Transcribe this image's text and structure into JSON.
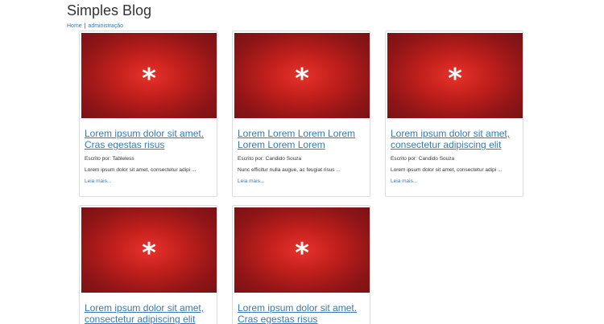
{
  "site": {
    "title": "Simples Blog"
  },
  "nav": {
    "home": "Home",
    "separator": "|",
    "admin": "administração"
  },
  "colors": {
    "link": "#337ab7",
    "thumb_center": "#e8322a",
    "thumb_edge": "#7a1215",
    "border": "#dddddd"
  },
  "thumbnail_glyph": "*",
  "posts": [
    {
      "title": "Lorem ipsum dolor sit amet. Cras egestas risus",
      "author": "Escrito por: Tableless",
      "excerpt": "Lorem ipsum dolor sit amet, consectetur adipi ...",
      "more": "Leia mais..."
    },
    {
      "title": "Lorem Lorem Lorem Lorem Lorem Lorem Lorem",
      "author": "Escrito por: Candido Souza",
      "excerpt": "Nunc efficitur nulla augue, ac feugiat risus ...",
      "more": "Leia mais..."
    },
    {
      "title": "Lorem ipsum dolor sit amet, consectetur adipiscing elit",
      "author": "Escrito por: Candido Souza",
      "excerpt": "Lorem ipsum dolor sit amet, consectetur adipi ...",
      "more": "Leia mais..."
    },
    {
      "title": "Lorem ipsum dolor sit amet, consectetur adipiscing elit",
      "author": "",
      "excerpt": "",
      "more": ""
    },
    {
      "title": "Lorem ipsum dolor sit amet. Cras egestas risus",
      "author": "",
      "excerpt": "",
      "more": ""
    }
  ]
}
